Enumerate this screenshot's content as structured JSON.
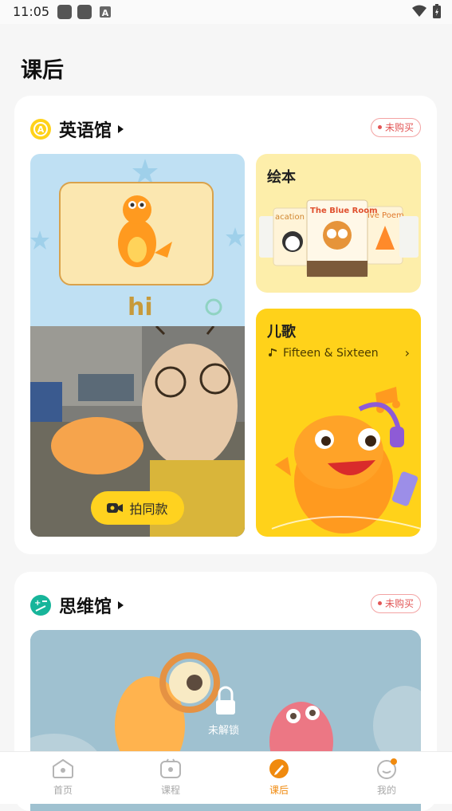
{
  "status": {
    "time": "11:05"
  },
  "page": {
    "title": "课后"
  },
  "english": {
    "title": "英语馆",
    "icon_letter": "A",
    "badge": "未购买",
    "video": {
      "caption": "hi",
      "button_label": "拍同款"
    },
    "picture_book": {
      "title": "绘本",
      "covers": [
        "acation",
        "The Blue Room",
        "ive Poem"
      ]
    },
    "songs": {
      "title": "儿歌",
      "current_song": "Fifteen & Sixteen"
    }
  },
  "thinking": {
    "title": "思维馆",
    "badge": "未购买",
    "lock_label": "未解锁"
  },
  "tabs": [
    {
      "label": "首页",
      "icon": "home-icon"
    },
    {
      "label": "课程",
      "icon": "course-icon"
    },
    {
      "label": "课后",
      "icon": "after-class-icon",
      "active": true
    },
    {
      "label": "我的",
      "icon": "profile-icon",
      "notify": true
    }
  ],
  "colors": {
    "accent": "#f08a0e",
    "yellow": "#ffd21a",
    "badge_red": "#e25656",
    "teal": "#17b59a"
  }
}
